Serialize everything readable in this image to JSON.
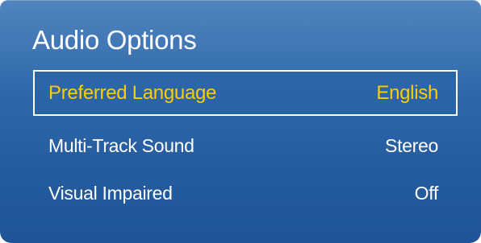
{
  "menu": {
    "title": "Audio Options",
    "items": [
      {
        "label": "Preferred Language",
        "value": "English",
        "selected": true
      },
      {
        "label": "Multi-Track Sound",
        "value": "Stereo",
        "selected": false
      },
      {
        "label": "Visual Impaired",
        "value": "Off",
        "selected": false
      }
    ]
  },
  "colors": {
    "panel_background": "#2f69ab",
    "highlight_text": "#ffcc00",
    "normal_text": "#ffffff",
    "selection_border": "#ffffff"
  }
}
